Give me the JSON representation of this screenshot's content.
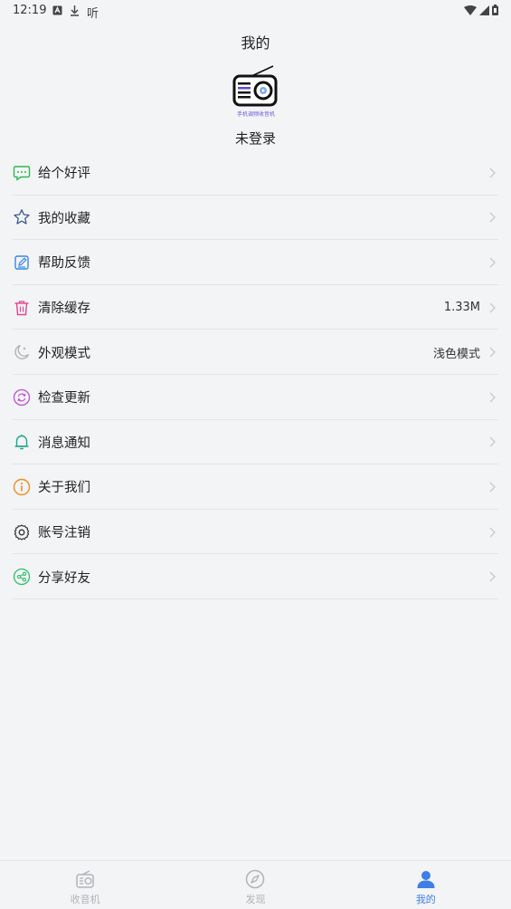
{
  "status_bar": {
    "time": "12:19",
    "left_icons": [
      "a-box-icon",
      "download-icon",
      "ting-app-icon"
    ],
    "ting_glyph": "听",
    "right_icons": [
      "wifi-icon",
      "signal-icon",
      "battery-icon"
    ]
  },
  "header": {
    "title": "我的",
    "logo_caption": "手机调频收音机",
    "login_status": "未登录"
  },
  "menu": {
    "items": [
      {
        "label": "给个好评",
        "icon": "chat-bubble-icon",
        "value": "",
        "color": "#2fb84f"
      },
      {
        "label": "我的收藏",
        "icon": "star-icon",
        "value": "",
        "color": "#3c5a8c"
      },
      {
        "label": "帮助反馈",
        "icon": "edit-note-icon",
        "value": "",
        "color": "#3a86e8"
      },
      {
        "label": "清除缓存",
        "icon": "trash-icon",
        "value": "1.33M",
        "color": "#e0468f"
      },
      {
        "label": "外观模式",
        "icon": "moon-icon",
        "value": "浅色模式",
        "color": "#b0b0b0"
      },
      {
        "label": "检查更新",
        "icon": "refresh-icon",
        "value": "",
        "color": "#c04fd6"
      },
      {
        "label": "消息通知",
        "icon": "bell-icon",
        "value": "",
        "color": "#1fa88a"
      },
      {
        "label": "关于我们",
        "icon": "info-icon",
        "value": "",
        "color": "#f08c1a"
      },
      {
        "label": "账号注销",
        "icon": "gear-icon",
        "value": "",
        "color": "#333333"
      },
      {
        "label": "分享好友",
        "icon": "share-icon",
        "value": "",
        "color": "#2fc26a"
      }
    ]
  },
  "bottom_nav": {
    "tabs": [
      {
        "label": "收音机",
        "icon": "radio-icon",
        "active": false
      },
      {
        "label": "发现",
        "icon": "compass-icon",
        "active": false
      },
      {
        "label": "我的",
        "icon": "person-icon",
        "active": true
      }
    ],
    "active_color": "#3f7ee6",
    "inactive_color": "#b0b3b8"
  }
}
